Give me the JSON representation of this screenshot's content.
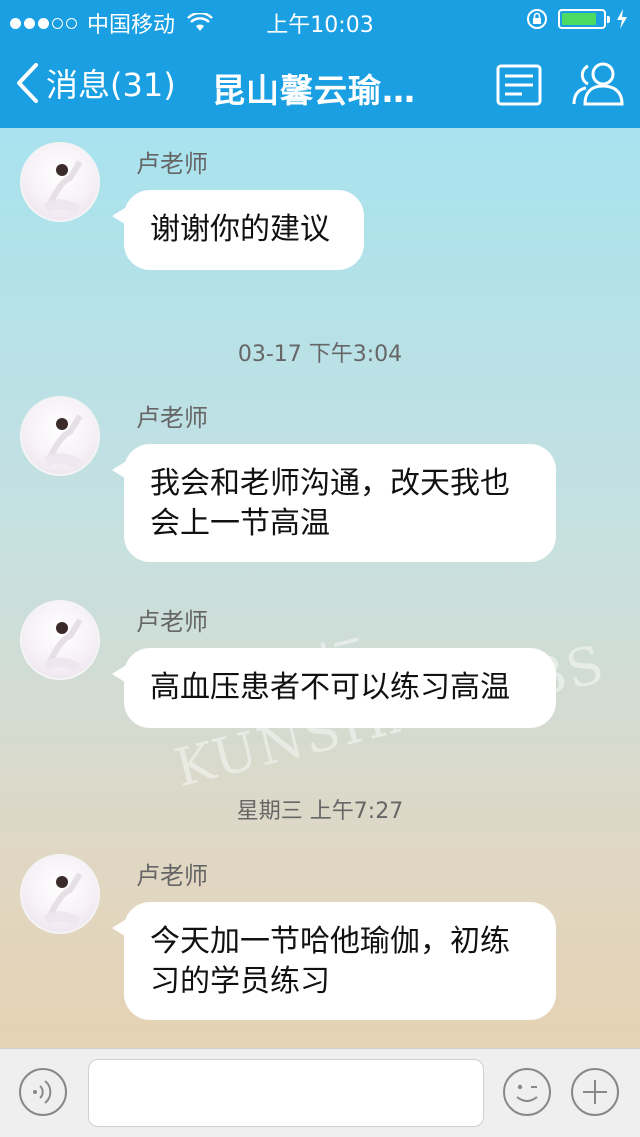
{
  "status_bar": {
    "carrier": "中国移动",
    "time": "上午10:03",
    "battery_level": 0.85
  },
  "nav": {
    "back_label": "消息(31)",
    "title": "昆山馨云瑜…",
    "menu_icon": "list-icon",
    "group_icon": "group-icon"
  },
  "messages": [
    {
      "sender": "卢老师",
      "lines": [
        "谢谢你的建议"
      ]
    },
    {
      "timestamp": "03-17 下午3:04"
    },
    {
      "sender": "卢老师",
      "lines": [
        "我会和老师沟通，改天我也",
        "会上一节高温"
      ]
    },
    {
      "sender": "卢老师",
      "lines": [
        "高血压患者不可以练习高温"
      ]
    },
    {
      "timestamp": "星期三 上午7:27"
    },
    {
      "sender": "卢老师",
      "lines": [
        "今天加一节哈他瑜伽，初练",
        "习的学员练习"
      ]
    }
  ],
  "watermark": "昆山论坛 KUNSHAN BBS",
  "input_bar": {
    "placeholder": "",
    "voice_icon": "voice-icon",
    "emoji_icon": "emoji-icon",
    "plus_icon": "plus-icon"
  },
  "colors": {
    "nav_bar": "#1a9fe2",
    "battery_fill": "#4cd964",
    "bubble": "#ffffff"
  }
}
